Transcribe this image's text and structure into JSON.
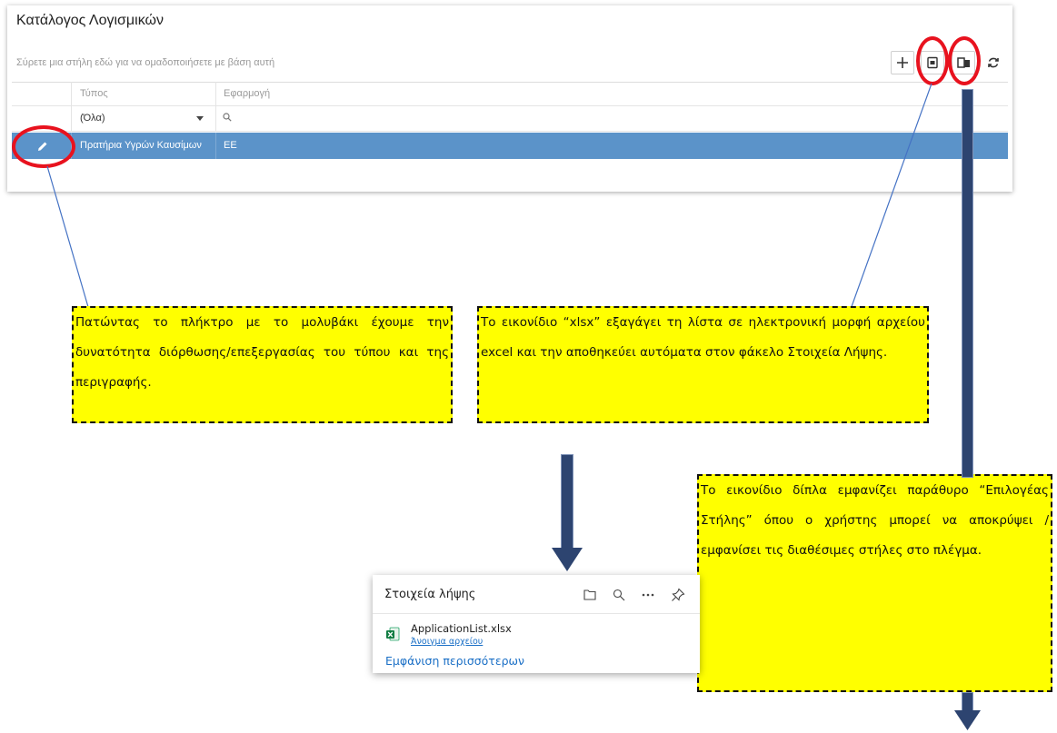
{
  "panel": {
    "title": "Κατάλογος Λογισμικών",
    "group_hint": "Σύρετε μια στήλη εδώ για να ομαδοποιήσετε με βάση αυτή",
    "toolbar": {
      "add_icon": "plus-icon",
      "export_icon": "xlsx-export-icon",
      "column_chooser_icon": "column-chooser-icon",
      "refresh_icon": "refresh-icon"
    },
    "columns": [
      "Τύπος",
      "Εφαρμογή"
    ],
    "filter": {
      "type_value": "(Όλα)",
      "search_icon": "search-icon"
    },
    "rows": [
      {
        "type": "Πρατήρια Υγρών Καυσίμων",
        "application": "ΕΕ"
      }
    ]
  },
  "callouts": {
    "edit": "Πατώντας το πλήκτρο με το μολυβάκι έχουμε την δυνατότητα διόρθωσης/επεξεργασίας του τύπου και της περιγραφής.",
    "export": "Το εικονίδιο “xlsx” εξαγάγει τη λίστα σε ηλεκτρονική μορφή αρχείου excel και την αποθηκεύει αυτόματα στον φάκελο Στοιχεία Λήψης.",
    "columns": "Το εικονίδιο δίπλα εμφανίζει παράθυρο “Επιλογέας Στήλης” όπου ο χρήστης μπορεί να αποκρύψει / εμφανίσει τις διαθέσιμες στήλες στο πλέγμα."
  },
  "downloads": {
    "title": "Στοιχεία λήψης",
    "file_name": "ApplicationList.xlsx",
    "open_link": "Άνοιγμα αρχείου",
    "show_more": "Εμφάνιση περισσότερων",
    "icons": [
      "folder-icon",
      "search-icon",
      "more-icon",
      "pin-icon"
    ]
  },
  "colors": {
    "selected_row": "#5b93c9",
    "highlight": "#ffff00",
    "annotation_ellipse": "#e8121e",
    "arrow": "#2d4470",
    "link": "#1a6fc6"
  }
}
